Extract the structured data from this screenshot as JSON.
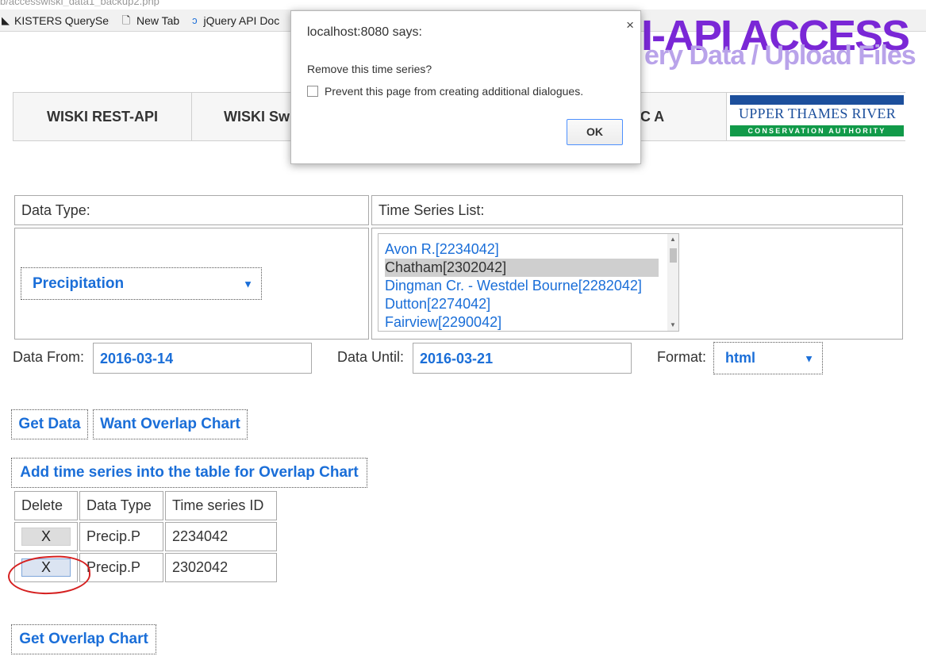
{
  "browser": {
    "url_fragment": "b/accesswiski_data1_backup2.php",
    "bookmarks": [
      {
        "label": "KISTERS QuerySer",
        "icon": "kisters-logo-icon"
      },
      {
        "label": "New Tab",
        "icon": "page-icon"
      },
      {
        "label": "jQuery API Doc",
        "icon": "jquery-logo-icon"
      }
    ]
  },
  "header": {
    "title": "I-API ACCESS",
    "subtitle": "ery Data / Upload Files"
  },
  "nav": {
    "items": [
      "WISKI REST-API",
      "WISKI Sw",
      "C A"
    ],
    "logo": {
      "line1": "UPPER THAMES RIVER",
      "line2": "CONSERVATION AUTHORITY"
    }
  },
  "form": {
    "data_type_label": "Data Type:",
    "data_type_value": "Precipitation",
    "time_series_label": "Time Series List:",
    "time_series_options": [
      "Avon R.[2234042]",
      "Chatham[2302042]",
      "Dingman Cr. - Westdel Bourne[2282042]",
      "Dutton[2274042]",
      "Fairview[2290042]"
    ],
    "selected_time_series": "Chatham[2302042]",
    "data_from_label": "Data From:",
    "data_from_value": "2016-03-14",
    "data_until_label": "Data Until:",
    "data_until_value": "2016-03-21",
    "format_label": "Format:",
    "format_value": "html"
  },
  "actions": {
    "get_data": "Get Data",
    "want_overlap": "Want Overlap Chart",
    "add_series": "Add time series into the table for Overlap Chart",
    "get_overlap": "Get Overlap Chart"
  },
  "overlap_table": {
    "headers": [
      "Delete",
      "Data Type",
      "Time series ID"
    ],
    "rows": [
      {
        "delete": "X",
        "type": "Precip.P",
        "id": "2234042"
      },
      {
        "delete": "X",
        "type": "Precip.P",
        "id": "2302042"
      }
    ]
  },
  "dialog": {
    "title": "localhost:8080 says:",
    "close": "×",
    "message": "Remove this time series?",
    "checkbox_label": "Prevent this page from creating additional dialogues.",
    "ok": "OK"
  },
  "colors": {
    "link_blue": "#1a6ed8",
    "title_purple": "#7a27d6",
    "annotation_red": "#d52020",
    "logo_blue": "#1c4f9c",
    "logo_green": "#119a49"
  }
}
